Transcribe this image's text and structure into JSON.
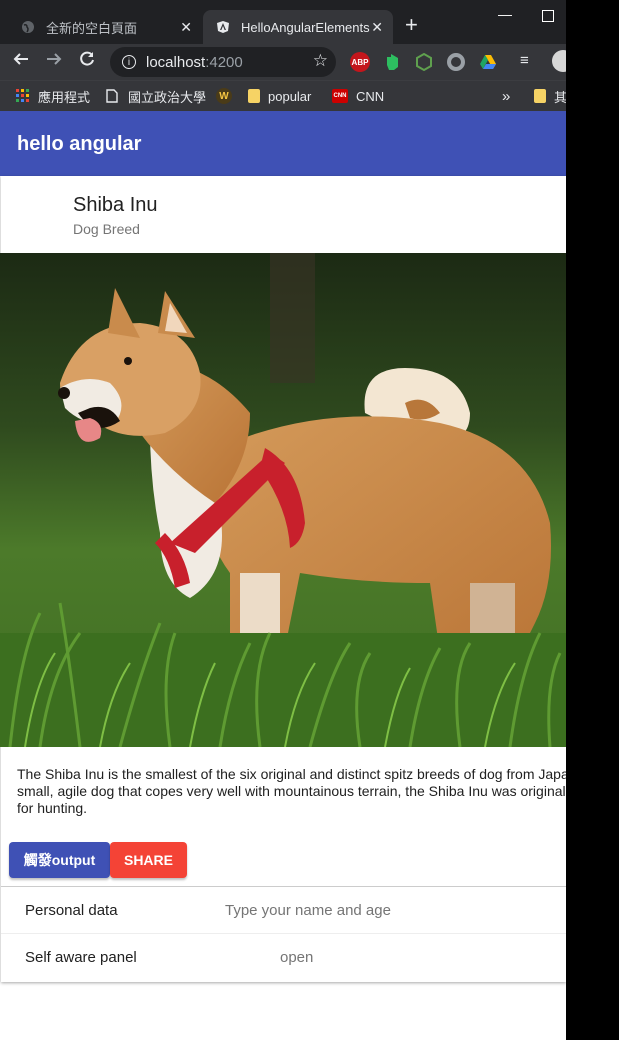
{
  "browser": {
    "tabs": [
      {
        "title": "全新的空白頁面",
        "active": false
      },
      {
        "title": "HelloAngularElements",
        "active": true
      }
    ],
    "new_tab_symbol": "+",
    "url_host": "localhost",
    "url_port": ":4200",
    "extensions": [
      "adblock-icon",
      "evernote-icon",
      "nodejs-icon",
      "circle-ext-icon",
      "google-drive-icon"
    ],
    "bookmarks": [
      {
        "label": "應用程式",
        "icon": "apps-grid-icon"
      },
      {
        "label": "國立政治大學",
        "icon": "page-icon"
      },
      {
        "label": "",
        "icon": "w-logo-icon"
      },
      {
        "label": "popular",
        "icon": "folder-icon"
      },
      {
        "label": "CNN",
        "icon": "cnn-logo-icon"
      },
      {
        "label": "其",
        "icon": "folder-icon"
      }
    ],
    "adblock_text": "ABP",
    "cnn_text": "CNN",
    "w_text": "W"
  },
  "app": {
    "toolbar_title": "hello angular",
    "card": {
      "title": "Shiba Inu",
      "subtitle": "Dog Breed",
      "description": "The Shiba Inu is the smallest of the six original and distinct spitz breeds of dog from Japan. A small, agile dog that copes very well with mountainous terrain, the Shiba Inu was originally bred for hunting.",
      "output_button": "觸發output",
      "share_button": "SHARE"
    },
    "panels": [
      {
        "title": "Personal data",
        "description": "Type your name and age"
      },
      {
        "title": "Self aware panel",
        "description": "open"
      }
    ]
  },
  "colors": {
    "primary": "#3f51b5",
    "accent": "#f44336"
  }
}
